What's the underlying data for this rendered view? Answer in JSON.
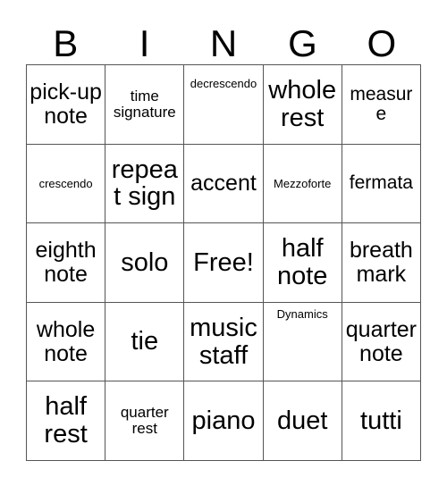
{
  "card": {
    "title": "Bingo Card",
    "header_letters": [
      "B",
      "I",
      "N",
      "G",
      "O"
    ],
    "free_space_label": "Free!",
    "border_color": "#555555",
    "text_color": "#000000",
    "background_color": "#ffffff",
    "rows": [
      [
        {
          "label": "pick-up note",
          "size": "fs-l",
          "valign": "v-center"
        },
        {
          "label": "time signature",
          "size": "fs-s",
          "valign": "v-center"
        },
        {
          "label": "decrescendo",
          "size": "fs-xs",
          "valign": "v-upper"
        },
        {
          "label": "whole rest",
          "size": "fs-xl",
          "valign": "v-center"
        },
        {
          "label": "measure",
          "size": "fs-m",
          "valign": "v-center"
        }
      ],
      [
        {
          "label": "crescendo",
          "size": "fs-xs",
          "valign": "v-center"
        },
        {
          "label": "repeat sign",
          "size": "fs-xl",
          "valign": "v-center"
        },
        {
          "label": "accent",
          "size": "fs-l",
          "valign": "v-center"
        },
        {
          "label": "Mezzoforte",
          "size": "fs-xs",
          "valign": "v-center"
        },
        {
          "label": "fermata",
          "size": "fs-m",
          "valign": "v-center"
        }
      ],
      [
        {
          "label": "eighth note",
          "size": "fs-l",
          "valign": "v-center"
        },
        {
          "label": "solo",
          "size": "fs-xl",
          "valign": "v-center"
        },
        {
          "label": "Free!",
          "size": "fs-xl",
          "valign": "v-center"
        },
        {
          "label": "half note",
          "size": "fs-xl",
          "valign": "v-center"
        },
        {
          "label": "breath mark",
          "size": "fs-l",
          "valign": "v-center"
        }
      ],
      [
        {
          "label": "whole note",
          "size": "fs-l",
          "valign": "v-center"
        },
        {
          "label": "tie",
          "size": "fs-xl",
          "valign": "v-center"
        },
        {
          "label": "music staff",
          "size": "fs-xl",
          "valign": "v-center"
        },
        {
          "label": "Dynamics",
          "size": "fs-xs",
          "valign": "v-top"
        },
        {
          "label": "quarter note",
          "size": "fs-l",
          "valign": "v-center"
        }
      ],
      [
        {
          "label": "half rest",
          "size": "fs-xl",
          "valign": "v-center"
        },
        {
          "label": "quarter rest",
          "size": "fs-s",
          "valign": "v-center"
        },
        {
          "label": "piano",
          "size": "fs-xl",
          "valign": "v-center"
        },
        {
          "label": "duet",
          "size": "fs-xl",
          "valign": "v-center"
        },
        {
          "label": "tutti",
          "size": "fs-xl",
          "valign": "v-center"
        }
      ]
    ]
  }
}
